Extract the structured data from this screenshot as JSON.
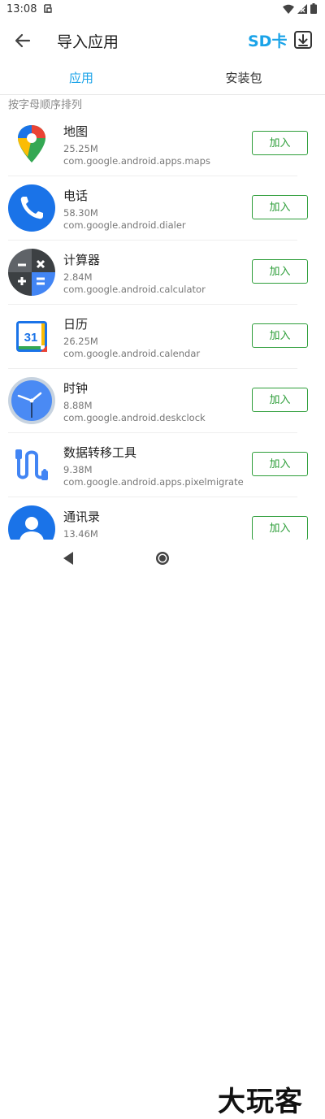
{
  "status_bar": {
    "time": "13:08"
  },
  "app_bar": {
    "title": "导入应用",
    "sd_label": "SD卡"
  },
  "tabs": [
    {
      "label": "应用",
      "active": true
    },
    {
      "label": "安装包",
      "active": false
    }
  ],
  "sort_label": "按字母顺序排列",
  "apps": [
    {
      "name": "地图",
      "size": "25.25M",
      "package": "com.google.android.apps.maps",
      "action": "加入",
      "icon": "maps-icon"
    },
    {
      "name": "电话",
      "size": "58.30M",
      "package": "com.google.android.dialer",
      "action": "加入",
      "icon": "phone-icon"
    },
    {
      "name": "计算器",
      "size": "2.84M",
      "package": "com.google.android.calculator",
      "action": "加入",
      "icon": "calculator-icon"
    },
    {
      "name": "日历",
      "size": "26.25M",
      "package": "com.google.android.calendar",
      "action": "加入",
      "icon": "calendar-icon",
      "icon_text": "31"
    },
    {
      "name": "时钟",
      "size": "8.88M",
      "package": "com.google.android.deskclock",
      "action": "加入",
      "icon": "clock-icon"
    },
    {
      "name": "数据转移工具",
      "size": "9.38M",
      "package": "com.google.android.apps.pixelmigrate",
      "action": "加入",
      "icon": "data-transfer-icon"
    },
    {
      "name": "通讯录",
      "size": "13.46M",
      "package": "",
      "action": "加入",
      "icon": "contacts-icon"
    }
  ],
  "watermark": "大玩客",
  "colors": {
    "accent": "#1aa3e8",
    "button": "#2e9e3a"
  }
}
